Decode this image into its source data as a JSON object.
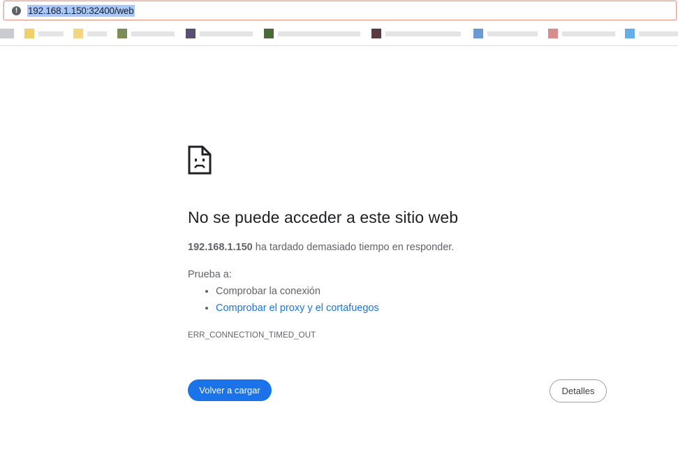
{
  "address_bar": {
    "url": "192.168.1.150:32400/web",
    "info_icon": "info-icon"
  },
  "bookmarks_bar": {
    "items": [
      {
        "favicon_color": "#c8cbd0"
      },
      {
        "favicon_color": "#f0cf6c"
      },
      {
        "favicon_color": "#f2d683"
      },
      {
        "favicon_color": "#7e8c5a"
      },
      {
        "favicon_color": "#5a4f70"
      },
      {
        "favicon_color": "#4a6a3a"
      },
      {
        "favicon_color": "#5a3b40"
      },
      {
        "favicon_color": "#6b9ad2"
      },
      {
        "favicon_color": "#d98c8c"
      },
      {
        "favicon_color": "#66aee8"
      }
    ]
  },
  "error_page": {
    "icon": "sad-page-icon",
    "title": "No se puede acceder a este sitio web",
    "host": "192.168.1.150",
    "message": "ha tardado demasiado tiempo en responder.",
    "try_label": "Prueba a:",
    "suggestions": [
      "Comprobar la conexión",
      "Comprobar el proxy y el cortafuegos"
    ],
    "error_code": "ERR_CONNECTION_TIMED_OUT",
    "reload_label": "Volver a cargar",
    "details_label": "Detalles"
  },
  "colors": {
    "accent": "#1a73e8",
    "text_primary": "#202124",
    "text_secondary": "#5f6368",
    "url_selection": "#a8c7fa"
  }
}
